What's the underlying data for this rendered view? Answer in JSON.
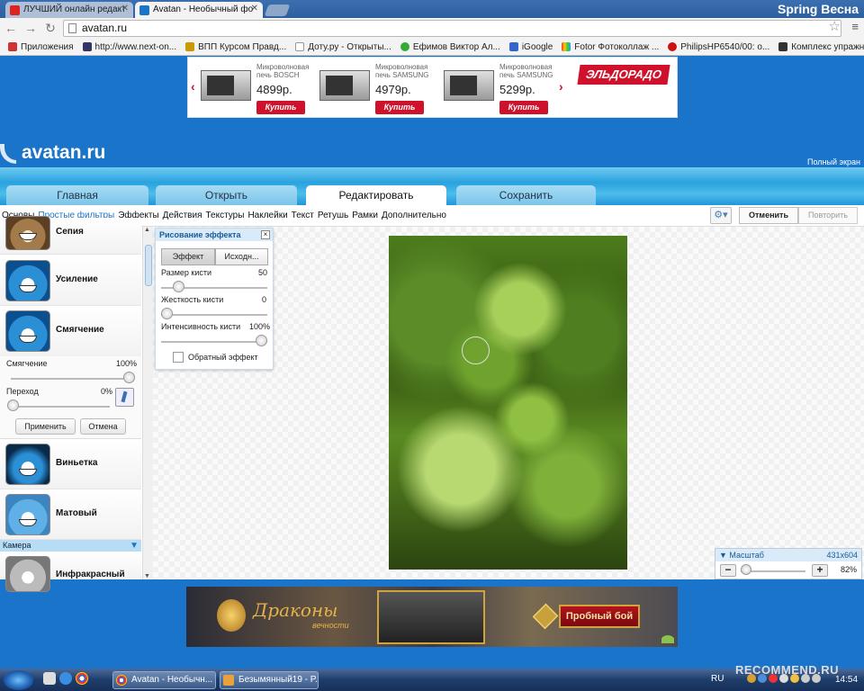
{
  "browser": {
    "tabs": [
      {
        "label": "ЛУЧШИЙ онлайн редакт",
        "active": false
      },
      {
        "label": "Avatan - Необычный фо",
        "active": true
      }
    ],
    "window_title": "Spring Весна",
    "address": "avatan.ru",
    "bookmarks": [
      {
        "label": "Приложения",
        "icon": "apps-icon",
        "color": "#c33"
      },
      {
        "label": "http://www.next-on...",
        "icon": "next-icon",
        "color": "#336"
      },
      {
        "label": "ВПП Курсом Правд...",
        "icon": "people-icon",
        "color": "#c90"
      },
      {
        "label": "Доту.ру - Открыты...",
        "icon": "page-icon",
        "color": "#ddd"
      },
      {
        "label": "Ефимов Виктор Ал...",
        "icon": "globe-icon",
        "color": "#3a3"
      },
      {
        "label": "iGoogle",
        "icon": "google-icon",
        "color": "#36c"
      },
      {
        "label": "Fotor Фотоколлаж ...",
        "icon": "fotor-icon",
        "color": "#e80"
      },
      {
        "label": "PhilipsHP6540/00: о...",
        "icon": "philips-icon",
        "color": "#c11"
      },
      {
        "label": "Комплекс упражне...",
        "icon": "star-figure-icon",
        "color": "#333"
      }
    ]
  },
  "ad_top": {
    "products": [
      {
        "caption": "Микроволновая печь BOSCH",
        "price": "4899р.",
        "buy": "Купить"
      },
      {
        "caption": "Микроволновая печь SAMSUNG",
        "price": "4979р.",
        "buy": "Купить"
      },
      {
        "caption": "Микроволновая печь SAMSUNG",
        "price": "5299р.",
        "buy": "Купить"
      }
    ],
    "brand": "ЭЛЬДОРАДО"
  },
  "site": {
    "logo": "avatan.ru",
    "fullscreen": "Полный экран",
    "main_tabs": [
      {
        "label": "Главная",
        "active": false
      },
      {
        "label": "Открыть",
        "active": false
      },
      {
        "label": "Редактировать",
        "active": true
      },
      {
        "label": "Сохранить",
        "active": false
      }
    ],
    "sub_menu": [
      {
        "label": "Основы",
        "active": false
      },
      {
        "label": "Простые фильтры",
        "active": true
      },
      {
        "label": "Эффекты",
        "active": false
      },
      {
        "label": "Действия",
        "active": false
      },
      {
        "label": "Текстуры",
        "active": false
      },
      {
        "label": "Наклейки",
        "active": false
      },
      {
        "label": "Текст",
        "active": false
      },
      {
        "label": "Ретушь",
        "active": false
      },
      {
        "label": "Рамки",
        "active": false
      },
      {
        "label": "Дополнительно",
        "active": false
      }
    ],
    "undo": "Отменить",
    "redo": "Повторить"
  },
  "filters": {
    "items": [
      {
        "name": "Сепия"
      },
      {
        "name": "Усиление"
      },
      {
        "name": "Смягчение"
      },
      {
        "name": "Виньетка"
      },
      {
        "name": "Матовый"
      },
      {
        "name": "Инфракрасный"
      }
    ],
    "soften": {
      "param1_label": "Смягчение",
      "param1_value": "100%",
      "param1_level": 1.0,
      "param2_label": "Переход",
      "param2_value": "0%",
      "param2_level": 0.0,
      "apply": "Применить",
      "cancel": "Отмена"
    },
    "section_camera": "Камера"
  },
  "effect_panel": {
    "title": "Рисование эффекта",
    "btn_effect": "Эффект",
    "btn_original": "Исходн...",
    "brush_size_label": "Размер кисти",
    "brush_size_value": "50",
    "brush_size_level": 0.2,
    "hardness_label": "Жесткость кисти",
    "hardness_value": "0",
    "hardness_level": 0.0,
    "intensity_label": "Интенсивность кисти",
    "intensity_value": "100%",
    "intensity_level": 1.0,
    "invert_label": "Обратный эффект"
  },
  "zoom": {
    "title": "Масштаб",
    "dims": "431x604",
    "value": "82%",
    "level": 0.1
  },
  "ad_bottom": {
    "title": "Драконы",
    "subtitle": "вечности",
    "button": "Пробный бой"
  },
  "taskbar": {
    "tasks": [
      "Avatan - Необычн...",
      "Безымянный19 - P..."
    ],
    "lang": "RU",
    "clock": "14:54"
  },
  "watermark": "RECOMMEND.RU"
}
